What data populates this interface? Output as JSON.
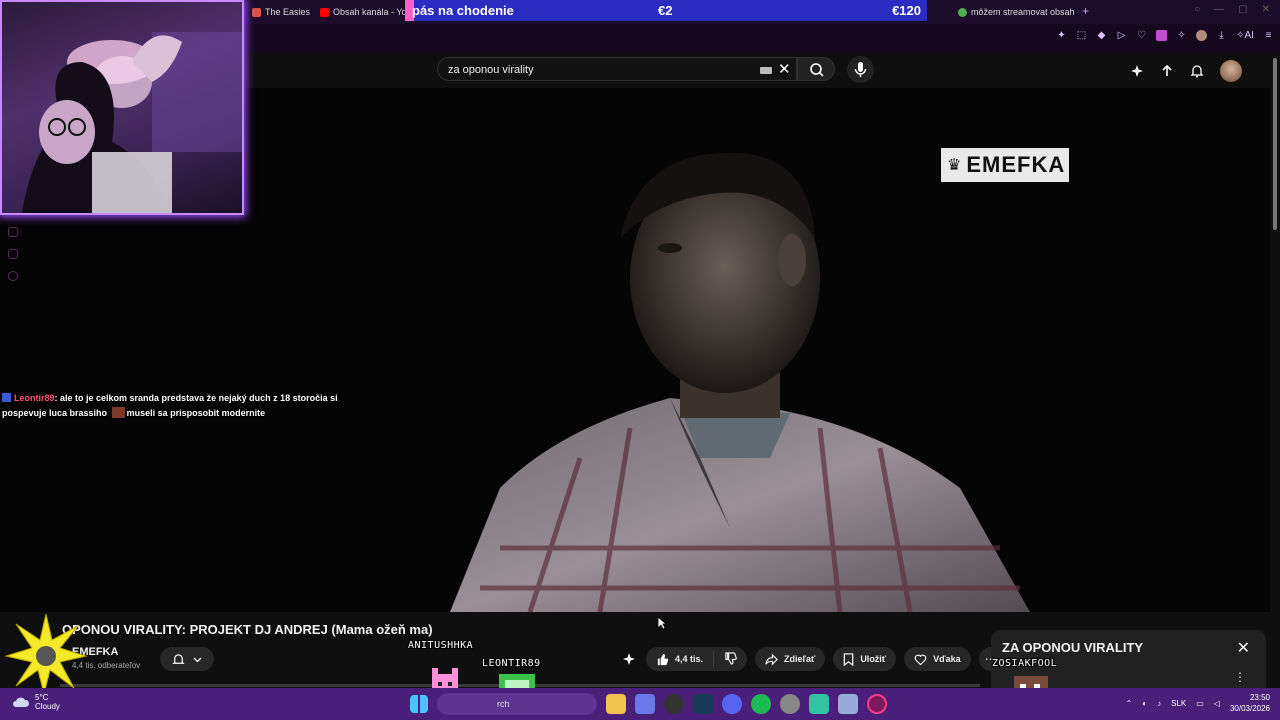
{
  "browser": {
    "tabs": [
      {
        "label": "The Easiest W",
        "favicon_color": "#d9534f"
      },
      {
        "label": "Obsah kanála - You",
        "favicon_color": "#ff0000"
      },
      {
        "label": "môžem streamovat obsah",
        "favicon_color": "#4caf50"
      }
    ],
    "new_tab_icon": "plus-icon"
  },
  "donation_goal": {
    "goal_label": "pás na chodenie",
    "current": "€2",
    "target": "€120",
    "progress_fraction": 0.0167,
    "bar_color": "#2a2bc0",
    "fill_color": "#ff5fc8"
  },
  "youtube": {
    "search_query": "za oponou virality",
    "video_title": "OPONOU VIRALITY: PROJEKT DJ ANDREJ (Mama ožeň ma)",
    "channel_name": "EMEFKA",
    "channel_logo_text": "EMEFKA",
    "subscribers": "4,4 tis. odberateľov",
    "likes": "4,4 tis.",
    "share_label": "Zdieľať",
    "save_label": "Uložiť",
    "thanks_label": "Vďaka",
    "playlist_title": "ZA OPONOU VIRALITY"
  },
  "chat": {
    "username": "Leontir89",
    "message_part1": ": ale to je celkom sranda predstava že nejaký duch z 18 storočia si pospevuje luca brassiho",
    "message_part2": "museli sa prisposobit modernite"
  },
  "overlay_names": {
    "viewer1": "ANITUSHHKA",
    "viewer2": "LEONTIR89",
    "viewer3": "ZOSIAKFOOL"
  },
  "taskbar": {
    "weather_temp": "5°C",
    "weather_desc": "Cloudy",
    "search_text": "rch",
    "language": "SLK",
    "time": "23:50",
    "date": "30/03/2026"
  },
  "colors": {
    "accent": "#c88bff",
    "taskbar": "#4a1f7a",
    "youtube_bg": "#0f0f0f"
  }
}
